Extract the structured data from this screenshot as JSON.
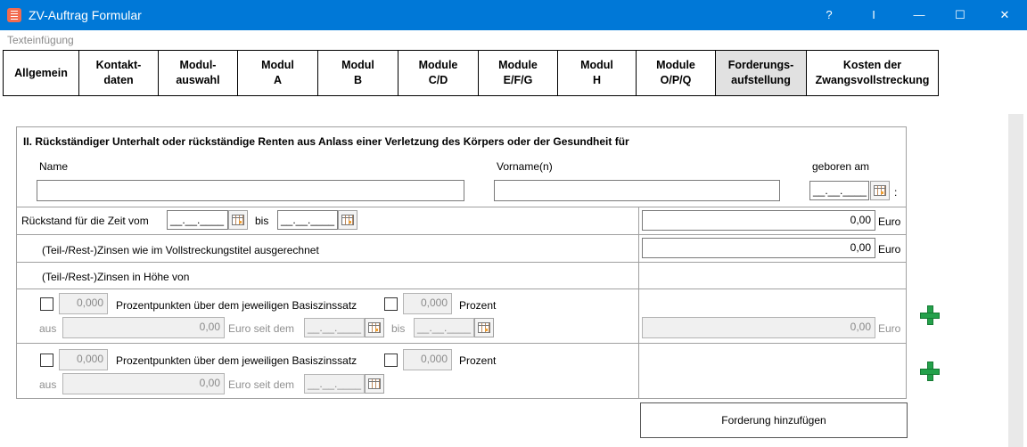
{
  "window": {
    "title": "ZV-Auftrag Formular",
    "help": "?",
    "pin": "I",
    "minimize": "—",
    "maximize": "☐",
    "close": "✕"
  },
  "menu": {
    "item": "Texteinfügung"
  },
  "tabs": [
    "Allgemein",
    "Kontakt-\ndaten",
    "Modul-\nauswahl",
    "Modul\nA",
    "Modul\nB",
    "Module\nC/D",
    "Module\nE/F/G",
    "Modul\nH",
    "Module\nO/P/Q",
    "Forderungs-\naufstellung",
    "Kosten der\nZwangsvollstreckung"
  ],
  "section": {
    "heading": "II. Rückständiger Unterhalt oder rückständige Renten aus Anlass einer Verletzung des Körpers oder der Gesundheit für",
    "name_label": "Name",
    "vorname_label": "Vorname(n)",
    "geboren_label": "geboren am",
    "name_value": "",
    "vorname_value": "",
    "geboren_value": "__.__.____",
    "geboren_colon": ":"
  },
  "rueckstand": {
    "label": "Rückstand für die Zeit vom",
    "from": "__.__.____",
    "bis_label": "bis",
    "to": "__.__.____",
    "amount": "0,00",
    "currency": "Euro"
  },
  "zinsen_titel": {
    "label": "(Teil-/Rest-)Zinsen wie im Vollstreckungstitel ausgerechnet",
    "amount": "0,00",
    "currency": "Euro"
  },
  "zinsen_hoehe": {
    "label": "(Teil-/Rest-)Zinsen in Höhe von"
  },
  "row1": {
    "pp_value": "0,000",
    "pp_label": "Prozentpunkten über dem jeweiligen Basiszinssatz",
    "pct_value": "0,000",
    "pct_label": "Prozent",
    "aus_label": "aus",
    "aus_value": "0,00",
    "seit_label": "Euro seit dem",
    "seit_date": "__.__.____",
    "bis_label": "bis",
    "bis_date": "__.__.____",
    "amount": "0,00",
    "currency": "Euro"
  },
  "row2": {
    "pp_value": "0,000",
    "pp_label": "Prozentpunkten über dem jeweiligen Basiszinssatz",
    "pct_value": "0,000",
    "pct_label": "Prozent",
    "aus_label": "aus",
    "aus_value": "0,00",
    "seit_label": "Euro seit dem",
    "seit_date": "__.__.____"
  },
  "add_claim_button": "Forderung hinzufügen"
}
